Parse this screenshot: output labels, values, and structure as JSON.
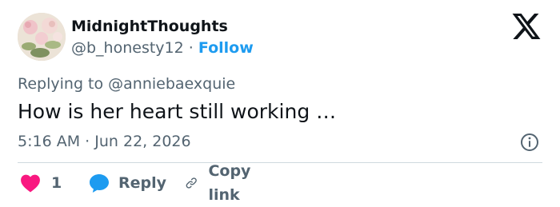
{
  "author": {
    "name": "MidnightThoughts",
    "handle": "@b_honesty12",
    "separator": "·",
    "follow_label": "Follow"
  },
  "brand_icon": "x-logo-icon",
  "replying_to": "Replying to @anniebaexquie",
  "tweet": {
    "text": "How is her heart still working …",
    "time": "5:16 AM",
    "date": "Jun 22, 2026",
    "separator": "·"
  },
  "actions": {
    "like_count": "1",
    "reply_label": "Reply",
    "copy_label": "Copy link"
  },
  "colors": {
    "accent": "#1d9bf0",
    "like": "#f91880",
    "text": "#0f1419",
    "muted": "#536471",
    "divider": "#cfd9de"
  }
}
